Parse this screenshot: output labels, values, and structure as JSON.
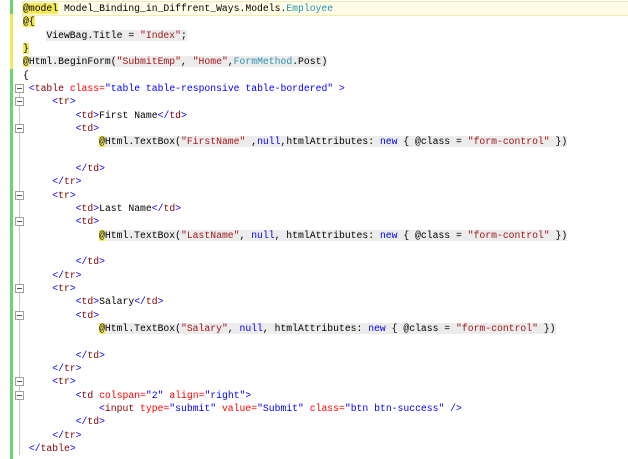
{
  "editor": {
    "colors": {
      "change_bar": "#6fd36f",
      "unsaved_bar": "#f2e85a",
      "string": "#a31515",
      "type": "#2b91af",
      "keyword": "#0000ff",
      "tag": "#800000",
      "attribute": "#ff0000"
    },
    "fold_lines": [
      6,
      7,
      9,
      14,
      16,
      21,
      23,
      28,
      29
    ],
    "lines": [
      [
        [
          "@model",
          "r"
        ],
        [
          " Model_Binding_in_Diffrent_Ways.Models.",
          "d"
        ],
        [
          "Employee",
          "t"
        ]
      ],
      [
        [
          "@{",
          "r"
        ]
      ],
      [
        [
          "    ",
          "d"
        ],
        [
          "ViewBag.Title = ",
          "d g"
        ],
        [
          "\"Index\"",
          "s g"
        ],
        [
          ";",
          "d g"
        ]
      ],
      [
        [
          "}",
          "r"
        ]
      ],
      [
        [
          "@",
          "r"
        ],
        [
          "Html.BeginForm(",
          "d g"
        ],
        [
          "\"SubmitEmp\"",
          "s g"
        ],
        [
          ", ",
          "d g"
        ],
        [
          "\"Home\"",
          "s g"
        ],
        [
          ",",
          "d g"
        ],
        [
          "FormMethod",
          "t g"
        ],
        [
          ".Post)",
          "d g"
        ]
      ],
      [
        [
          "{",
          "d"
        ]
      ],
      [
        [
          " ",
          "d"
        ],
        [
          "<",
          "p"
        ],
        [
          "table",
          "n"
        ],
        [
          " class=",
          "a"
        ],
        [
          "\"table table-responsive table-bordered\"",
          "v"
        ],
        [
          " >",
          "p"
        ]
      ],
      [
        [
          "     ",
          "d"
        ],
        [
          "<",
          "p"
        ],
        [
          "tr",
          "n"
        ],
        [
          ">",
          "p"
        ]
      ],
      [
        [
          "         ",
          "d"
        ],
        [
          "<",
          "p"
        ],
        [
          "td",
          "n"
        ],
        [
          ">",
          "p"
        ],
        [
          "First Name",
          "d"
        ],
        [
          "</",
          "p"
        ],
        [
          "td",
          "n"
        ],
        [
          ">",
          "p"
        ]
      ],
      [
        [
          "         ",
          "d"
        ],
        [
          "<",
          "p"
        ],
        [
          "td",
          "n"
        ],
        [
          ">",
          "p"
        ]
      ],
      [
        [
          "             ",
          "d"
        ],
        [
          "@",
          "r"
        ],
        [
          "Html.TextBox(",
          "d g"
        ],
        [
          "\"FirstName\"",
          "s g"
        ],
        [
          " ,",
          "d g"
        ],
        [
          "null",
          "k g"
        ],
        [
          ",htmlAttributes: ",
          "d g"
        ],
        [
          "new",
          "k g"
        ],
        [
          " { @class = ",
          "d g"
        ],
        [
          "\"form-control\"",
          "s g"
        ],
        [
          " })",
          "d g"
        ]
      ],
      [],
      [
        [
          "         ",
          "d"
        ],
        [
          "</",
          "p"
        ],
        [
          "td",
          "n"
        ],
        [
          ">",
          "p"
        ]
      ],
      [
        [
          "     ",
          "d"
        ],
        [
          "</",
          "p"
        ],
        [
          "tr",
          "n"
        ],
        [
          ">",
          "p"
        ]
      ],
      [
        [
          "     ",
          "d"
        ],
        [
          "<",
          "p"
        ],
        [
          "tr",
          "n"
        ],
        [
          ">",
          "p"
        ]
      ],
      [
        [
          "         ",
          "d"
        ],
        [
          "<",
          "p"
        ],
        [
          "td",
          "n"
        ],
        [
          ">",
          "p"
        ],
        [
          "Last Name",
          "d"
        ],
        [
          "</",
          "p"
        ],
        [
          "td",
          "n"
        ],
        [
          ">",
          "p"
        ]
      ],
      [
        [
          "         ",
          "d"
        ],
        [
          "<",
          "p"
        ],
        [
          "td",
          "n"
        ],
        [
          ">",
          "p"
        ]
      ],
      [
        [
          "             ",
          "d"
        ],
        [
          "@",
          "r"
        ],
        [
          "Html.TextBox(",
          "d g"
        ],
        [
          "\"LastName\"",
          "s g"
        ],
        [
          ", ",
          "d g"
        ],
        [
          "null",
          "k g"
        ],
        [
          ", htmlAttributes: ",
          "d g"
        ],
        [
          "new",
          "k g"
        ],
        [
          " { @class = ",
          "d g"
        ],
        [
          "\"form-control\"",
          "s g"
        ],
        [
          " })",
          "d g"
        ]
      ],
      [],
      [
        [
          "         ",
          "d"
        ],
        [
          "</",
          "p"
        ],
        [
          "td",
          "n"
        ],
        [
          ">",
          "p"
        ]
      ],
      [
        [
          "     ",
          "d"
        ],
        [
          "</",
          "p"
        ],
        [
          "tr",
          "n"
        ],
        [
          ">",
          "p"
        ]
      ],
      [
        [
          "     ",
          "d"
        ],
        [
          "<",
          "p"
        ],
        [
          "tr",
          "n"
        ],
        [
          ">",
          "p"
        ]
      ],
      [
        [
          "         ",
          "d"
        ],
        [
          "<",
          "p"
        ],
        [
          "td",
          "n"
        ],
        [
          ">",
          "p"
        ],
        [
          "Salary",
          "d"
        ],
        [
          "</",
          "p"
        ],
        [
          "td",
          "n"
        ],
        [
          ">",
          "p"
        ]
      ],
      [
        [
          "         ",
          "d"
        ],
        [
          "<",
          "p"
        ],
        [
          "td",
          "n"
        ],
        [
          ">",
          "p"
        ]
      ],
      [
        [
          "             ",
          "d"
        ],
        [
          "@",
          "r"
        ],
        [
          "Html.TextBox(",
          "d g"
        ],
        [
          "\"Salary\"",
          "s g"
        ],
        [
          ", ",
          "d g"
        ],
        [
          "null",
          "k g"
        ],
        [
          ", htmlAttributes: ",
          "d g"
        ],
        [
          "new",
          "k g"
        ],
        [
          " { @class = ",
          "d g"
        ],
        [
          "\"form-control\"",
          "s g"
        ],
        [
          " })",
          "d g"
        ]
      ],
      [],
      [
        [
          "         ",
          "d"
        ],
        [
          "</",
          "p"
        ],
        [
          "td",
          "n"
        ],
        [
          ">",
          "p"
        ]
      ],
      [
        [
          "     ",
          "d"
        ],
        [
          "</",
          "p"
        ],
        [
          "tr",
          "n"
        ],
        [
          ">",
          "p"
        ]
      ],
      [
        [
          "     ",
          "d"
        ],
        [
          "<",
          "p"
        ],
        [
          "tr",
          "n"
        ],
        [
          ">",
          "p"
        ]
      ],
      [
        [
          "         ",
          "d"
        ],
        [
          "<",
          "p"
        ],
        [
          "td",
          "n"
        ],
        [
          " colspan=",
          "a"
        ],
        [
          "\"2\"",
          "v"
        ],
        [
          " align=",
          "a"
        ],
        [
          "\"right\"",
          "v"
        ],
        [
          ">",
          "p"
        ]
      ],
      [
        [
          "             ",
          "d"
        ],
        [
          "<",
          "p"
        ],
        [
          "input",
          "n"
        ],
        [
          " type=",
          "a"
        ],
        [
          "\"submit\"",
          "v"
        ],
        [
          " value=",
          "a"
        ],
        [
          "\"Submit\"",
          "v"
        ],
        [
          " class=",
          "a"
        ],
        [
          "\"btn btn-success\"",
          "v"
        ],
        [
          " />",
          "p"
        ]
      ],
      [
        [
          "         ",
          "d"
        ],
        [
          "</",
          "p"
        ],
        [
          "td",
          "n"
        ],
        [
          ">",
          "p"
        ]
      ],
      [
        [
          "     ",
          "d"
        ],
        [
          "</",
          "p"
        ],
        [
          "tr",
          "n"
        ],
        [
          ">",
          "p"
        ]
      ],
      [
        [
          " ",
          "d"
        ],
        [
          "</",
          "p"
        ],
        [
          "table",
          "n"
        ],
        [
          ">",
          "p"
        ]
      ]
    ]
  }
}
